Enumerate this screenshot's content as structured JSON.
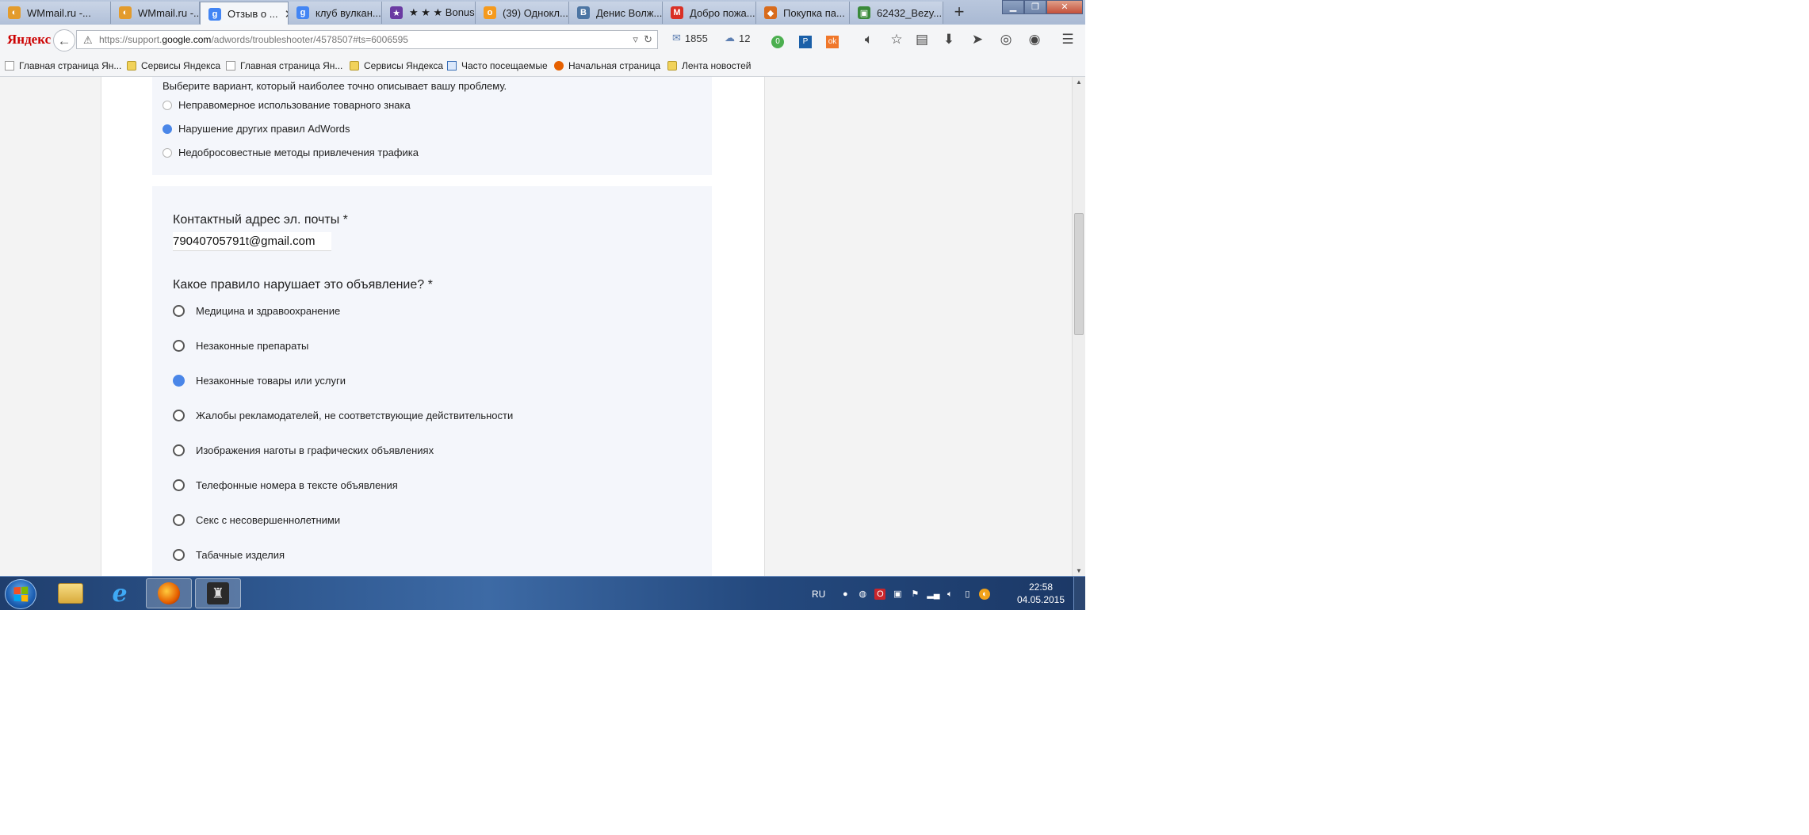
{
  "tabs": [
    {
      "label": "WMmail.ru -...",
      "icon": "wmmail-icon",
      "color": "#e39b2c"
    },
    {
      "label": "WMmail.ru -...",
      "icon": "wmmail-icon",
      "color": "#e39b2c"
    },
    {
      "label": "Отзыв о ...",
      "icon": "google-icon",
      "color": "#4285f4",
      "active": true
    },
    {
      "label": "клуб вулкан...",
      "icon": "google-search-icon",
      "color": "#4285f4"
    },
    {
      "label": "★ ★ ★ Bonus",
      "icon": "bonus-icon",
      "color": "#6a3aa2"
    },
    {
      "label": "(39) Однокл...",
      "icon": "odnoklassniki-icon",
      "color": "#f59a1d"
    },
    {
      "label": "Денис Волж...",
      "icon": "vk-icon",
      "color": "#4c75a3"
    },
    {
      "label": "Добро пожа...",
      "icon": "gmail-icon",
      "color": "#d93025"
    },
    {
      "label": "Покупка па...",
      "icon": "shop-icon",
      "color": "#d86b1c"
    },
    {
      "label": "62432_Bezy...",
      "icon": "image-icon",
      "color": "#3a8a3a"
    }
  ],
  "toolbar": {
    "brand": "Яндекс",
    "url_prefix": "https://support.",
    "url_host": "google.com",
    "url_rest": "/adwords/troubleshooter/4578507#ts=6006595",
    "mail_count": "1855",
    "weather_value": "12"
  },
  "bookmarks": [
    {
      "label": "Главная страница Ян...",
      "type": "page"
    },
    {
      "label": "Сервисы Яндекса",
      "type": "folder"
    },
    {
      "label": "Главная страница Ян...",
      "type": "page"
    },
    {
      "label": "Сервисы Яндекса",
      "type": "folder"
    },
    {
      "label": "Часто посещаемые",
      "type": "page"
    },
    {
      "label": "Начальная страница",
      "type": "page"
    },
    {
      "label": "Лента новостей",
      "type": "folder"
    }
  ],
  "form": {
    "prompt": "Выберите вариант, который наиболее точно описывает вашу проблему.",
    "problem_options": [
      {
        "label": "Неправомерное использование товарного знака",
        "selected": false
      },
      {
        "label": "Нарушение других правил AdWords",
        "selected": true
      },
      {
        "label": "Недобросовестные методы привлечения трафика",
        "selected": false
      }
    ],
    "email_label": "Контактный адрес эл. почты *",
    "email_value": "79040705791t@gmail.com",
    "rule_label": "Какое правило нарушает это объявление? *",
    "rule_options": [
      {
        "label": "Медицина и здравоохранение",
        "selected": false
      },
      {
        "label": "Незаконные препараты",
        "selected": false
      },
      {
        "label": "Незаконные товары или услуги",
        "selected": true
      },
      {
        "label": "Жалобы рекламодателей, не соответствующие действительности",
        "selected": false
      },
      {
        "label": "Изображения наготы в графических объявлениях",
        "selected": false
      },
      {
        "label": "Телефонные номера в тексте объявления",
        "selected": false
      },
      {
        "label": "Секс с несовершеннолетними",
        "selected": false
      },
      {
        "label": "Табачные изделия",
        "selected": false
      }
    ]
  },
  "taskbar": {
    "language": "RU",
    "time": "22:58",
    "date": "04.05.2015"
  },
  "colors": {
    "accent": "#4a86e8",
    "card_bg": "#f4f6fb"
  }
}
